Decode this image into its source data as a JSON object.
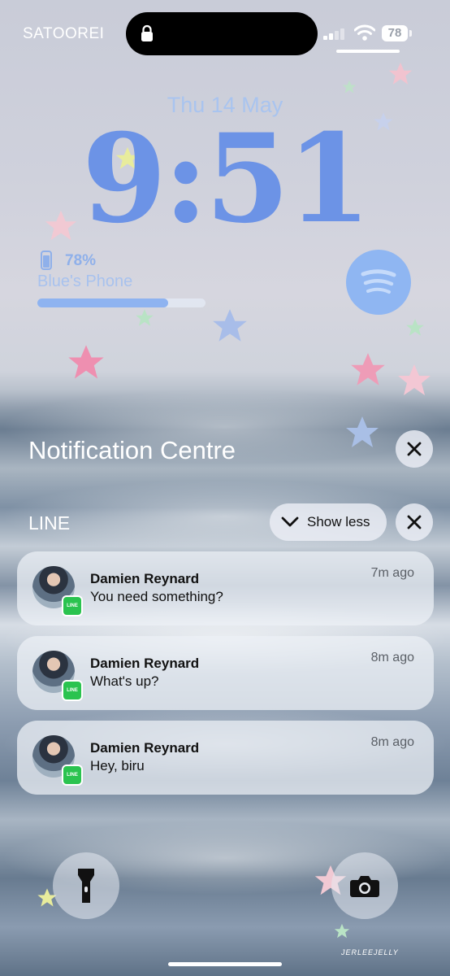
{
  "status_bar": {
    "carrier": "SATOOREI",
    "battery_percent": "78"
  },
  "lock_screen": {
    "date": "Thu 14 May",
    "time": "9:51",
    "battery_widget": {
      "percent": "78%",
      "device_name": "Blue's Phone",
      "level": 0.78
    },
    "signature": "JERLEEJELLY"
  },
  "notification_centre": {
    "title": "Notification Centre",
    "group": {
      "app_name": "LINE",
      "show_less_label": "Show less",
      "badge_text": "LINE",
      "notifications": [
        {
          "sender": "Damien Reynard",
          "message": "You need something?",
          "time": "7m ago"
        },
        {
          "sender": "Damien Reynard",
          "message": "What's up?",
          "time": "8m ago"
        },
        {
          "sender": "Damien Reynard",
          "message": "Hey, biru",
          "time": "8m ago"
        }
      ]
    }
  },
  "colors": {
    "clock": "#6c93e6",
    "date": "#a9c4ef",
    "spotify_widget": "#8fb6f2",
    "line_green": "#2ac34f"
  }
}
